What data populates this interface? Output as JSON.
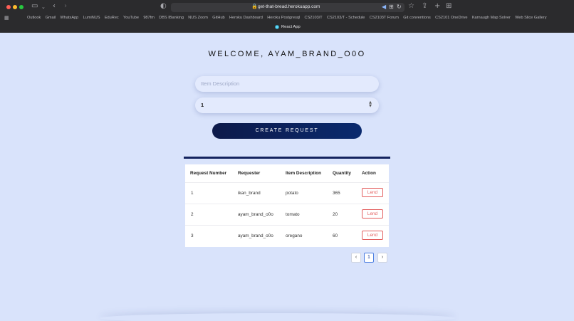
{
  "browser": {
    "url": "get-that-bread.herokuapp.com",
    "bookmarks": [
      "Outlook",
      "Gmail",
      "WhatsApp",
      "LumiNUS",
      "EduRec",
      "YouTube",
      "987fm",
      "DBS IBanking",
      "NUS Zoom",
      "GitHub",
      "Heroku Dashboard",
      "Heroku Postgresql",
      "CS2103/T",
      "CS2103/T - Schedule",
      "CS2103T Forum",
      "Git conventions",
      "CS2101 OneDrive",
      "Karnaugh Map Solver",
      "Web Slice Gallery"
    ],
    "active_tab": "React App"
  },
  "page": {
    "welcome": "WELCOME, AYAM_BRAND_O0O",
    "description_placeholder": "Item Description",
    "quantity_value": "1",
    "create_button": "CREATE REQUEST"
  },
  "table": {
    "headers": [
      "Request Number",
      "Requester",
      "Item Description",
      "Quantity",
      "Action"
    ],
    "rows": [
      {
        "number": "1",
        "requester": "ikan_brand",
        "item": "potato",
        "quantity": "365",
        "action": "Lend"
      },
      {
        "number": "2",
        "requester": "ayam_brand_o0o",
        "item": "tomato",
        "quantity": "20",
        "action": "Lend"
      },
      {
        "number": "3",
        "requester": "ayam_brand_o0o",
        "item": "oregano",
        "quantity": "60",
        "action": "Lend"
      }
    ]
  },
  "pagination": {
    "prev": "‹",
    "page": "1",
    "next": "›"
  }
}
